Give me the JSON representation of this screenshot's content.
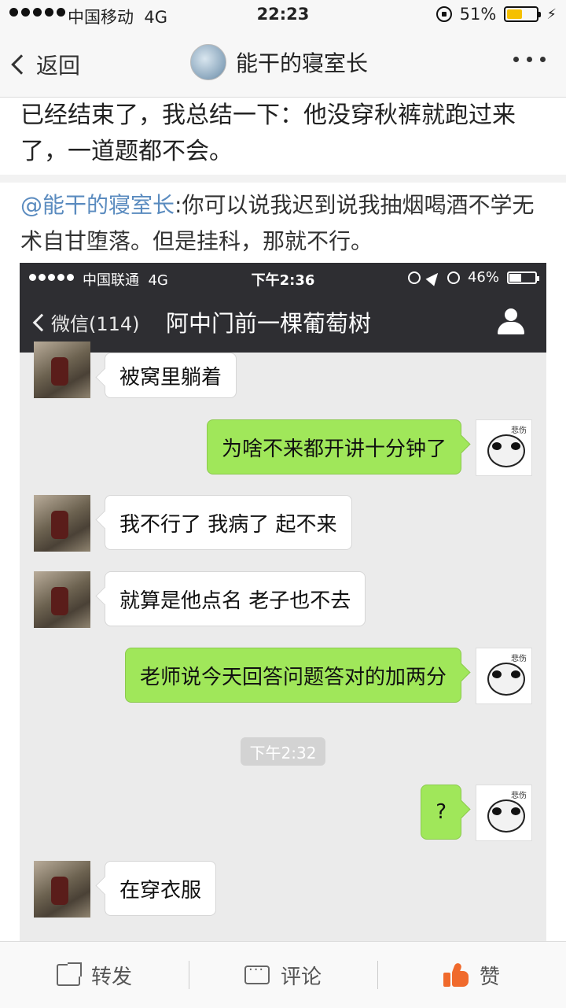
{
  "status_bar": {
    "carrier": "中国移动",
    "network": "4G",
    "time": "22:23",
    "battery_percent": "51%",
    "battery_level": 0.51
  },
  "nav": {
    "back_label": "返回",
    "title": "能干的寝室长"
  },
  "post": {
    "prev_text": "已经结束了，我总结一下：他没穿秋裤就跑过来了，一道题都不会。",
    "mention": "@能干的寝室长",
    "quote_text": ":你可以说我迟到说我抽烟喝酒不学无术自甘堕落。但是挂科，那就不行。"
  },
  "embedded_screenshot": {
    "status": {
      "carrier": "中国联通",
      "network": "4G",
      "time": "下午2:36",
      "battery_percent": "46%",
      "battery_level": 0.46
    },
    "nav": {
      "back_label": "微信(114)",
      "title": "阿中门前一棵葡萄树"
    },
    "avatar_tag": "悲伤",
    "time_divider": "下午2:32",
    "messages": [
      {
        "side": "left",
        "text": "被窝里躺着"
      },
      {
        "side": "right",
        "text": "为啥不来都开讲十分钟了"
      },
      {
        "side": "left",
        "text": "我不行了 我病了 起不来"
      },
      {
        "side": "left",
        "text": "就算是他点名 老子也不去"
      },
      {
        "side": "right",
        "text": "老师说今天回答问题答对的加两分"
      },
      {
        "side": "right",
        "text": "?"
      },
      {
        "side": "left",
        "text": "在穿衣服"
      }
    ]
  },
  "toolbar": {
    "repost_label": "转发",
    "comment_label": "评论",
    "like_label": "赞"
  },
  "colors": {
    "mention": "#5a8bbf",
    "bubble_sent": "#a0e75a",
    "like_icon": "#f06a2c",
    "battery_fill": "#f5c000"
  }
}
